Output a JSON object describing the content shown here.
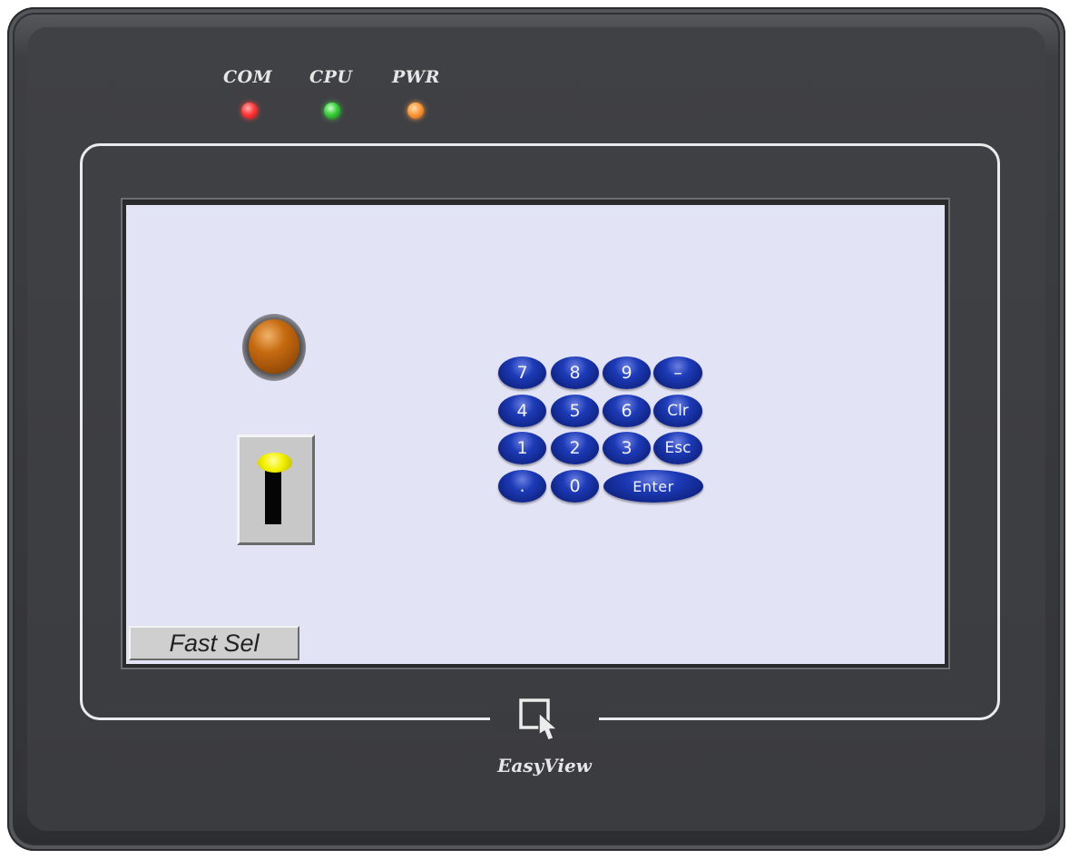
{
  "device": {
    "brand_logo": "EasyView",
    "leds": [
      {
        "label": "COM",
        "color": "#ff3b3b"
      },
      {
        "label": "CPU",
        "color": "#3ccf3c"
      },
      {
        "label": "PWR",
        "color": "#ff9a3b"
      }
    ]
  },
  "screen": {
    "background": "#e3e3f6",
    "indicator_lamp": {
      "icon": "lamp-icon",
      "color": "#c66a10"
    },
    "toggle_switch": {
      "icon": "toggle-switch-icon",
      "knob_color": "#f3f000"
    },
    "keypad": {
      "keys": [
        [
          "7",
          "8",
          "9",
          "–"
        ],
        [
          "4",
          "5",
          "6",
          "Clr"
        ],
        [
          "1",
          "2",
          "3",
          "Esc"
        ],
        [
          ".",
          "0",
          "Enter"
        ]
      ],
      "key_color": "#1d3bb8"
    },
    "fast_sel_button": "Fast Sel"
  }
}
